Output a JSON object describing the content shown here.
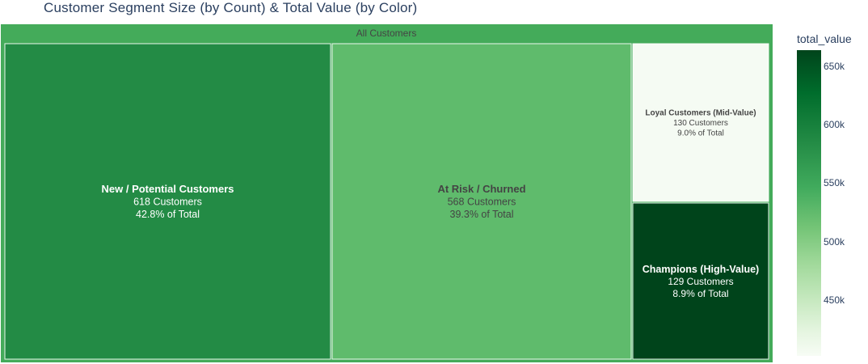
{
  "title": "Customer Segment Size (by Count) & Total Value (by Color)",
  "chart_data": {
    "type": "treemap",
    "root": {
      "label": "All Customers"
    },
    "nodes": [
      {
        "label": "New / Potential Customers",
        "count_text": "618 Customers",
        "share_text": "42.8% of Total",
        "count": 618,
        "share": 42.8,
        "total_value": 585000,
        "color": "#238b45",
        "text_color": "#ffffff"
      },
      {
        "label": "At Risk / Churned",
        "count_text": "568 Customers",
        "share_text": "39.3% of Total",
        "count": 568,
        "share": 39.3,
        "total_value": 548000,
        "color": "#5fbb6c",
        "text_color": "#444444"
      },
      {
        "label": "Loyal Customers (Mid-Value)",
        "count_text": "130 Customers",
        "share_text": "9.0% of Total",
        "count": 130,
        "share": 9.0,
        "total_value": 405000,
        "color": "#f5fbf3",
        "text_color": "#444444"
      },
      {
        "label": "Champions (High-Value)",
        "count_text": "129 Customers",
        "share_text": "8.9% of Total",
        "count": 129,
        "share": 8.9,
        "total_value": 662000,
        "color": "#00441b",
        "text_color": "#ffffff"
      }
    ],
    "colorbar": {
      "title": "total_value",
      "ticks": [
        {
          "label": "650k",
          "value": 650000
        },
        {
          "label": "600k",
          "value": 600000
        },
        {
          "label": "550k",
          "value": 550000
        },
        {
          "label": "500k",
          "value": 500000
        },
        {
          "label": "450k",
          "value": 450000
        }
      ],
      "range": [
        402000,
        664000
      ],
      "colorscale": "Greens"
    }
  }
}
